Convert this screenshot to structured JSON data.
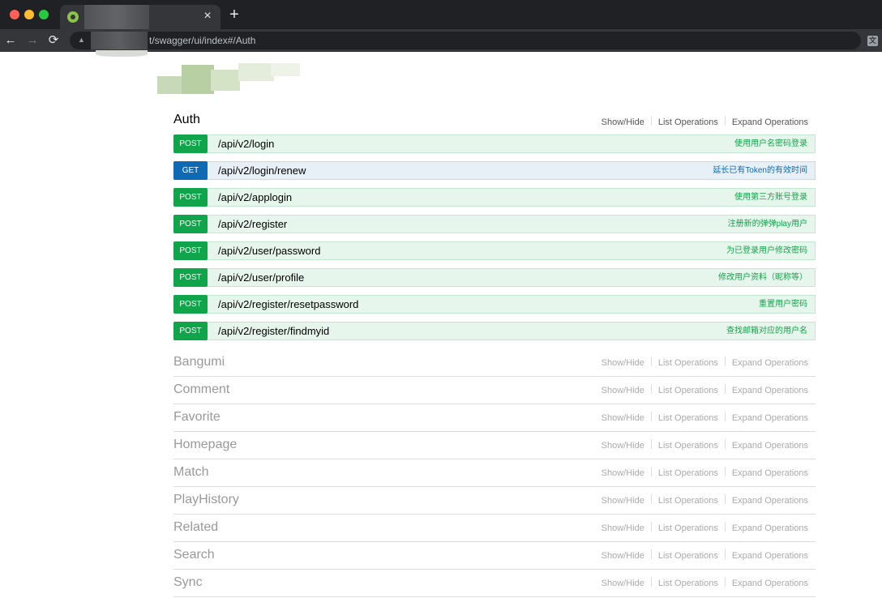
{
  "browser": {
    "tab_close": "×",
    "new_tab": "+",
    "back": "←",
    "forward": "→",
    "reload": "⟳",
    "url_visible": "t/swagger/ui/index#/Auth"
  },
  "colors": {
    "post": "#10a54a",
    "get": "#0f6ab4",
    "post_bg": "#e7f6ec",
    "get_bg": "#e7f0f7"
  },
  "resource_links": {
    "show_hide": "Show/Hide",
    "list_operations": "List Operations",
    "expand_operations": "Expand Operations"
  },
  "auth": {
    "name": "Auth",
    "operations": [
      {
        "method": "POST",
        "path": "/api/v2/login",
        "summary": "使用用户名密码登录"
      },
      {
        "method": "GET",
        "path": "/api/v2/login/renew",
        "summary": "延长已有Token的有效时间"
      },
      {
        "method": "POST",
        "path": "/api/v2/applogin",
        "summary": "使用第三方账号登录"
      },
      {
        "method": "POST",
        "path": "/api/v2/register",
        "summary": "注册新的弹弹play用户"
      },
      {
        "method": "POST",
        "path": "/api/v2/user/password",
        "summary": "为已登录用户修改密码"
      },
      {
        "method": "POST",
        "path": "/api/v2/user/profile",
        "summary": "修改用户资料（昵称等）"
      },
      {
        "method": "POST",
        "path": "/api/v2/register/resetpassword",
        "summary": "重置用户密码"
      },
      {
        "method": "POST",
        "path": "/api/v2/register/findmyid",
        "summary": "查找邮箱对应的用户名"
      }
    ]
  },
  "resources": [
    {
      "name": "Bangumi"
    },
    {
      "name": "Comment"
    },
    {
      "name": "Favorite"
    },
    {
      "name": "Homepage"
    },
    {
      "name": "Match"
    },
    {
      "name": "PlayHistory"
    },
    {
      "name": "Related"
    },
    {
      "name": "Search"
    },
    {
      "name": "Sync"
    }
  ]
}
